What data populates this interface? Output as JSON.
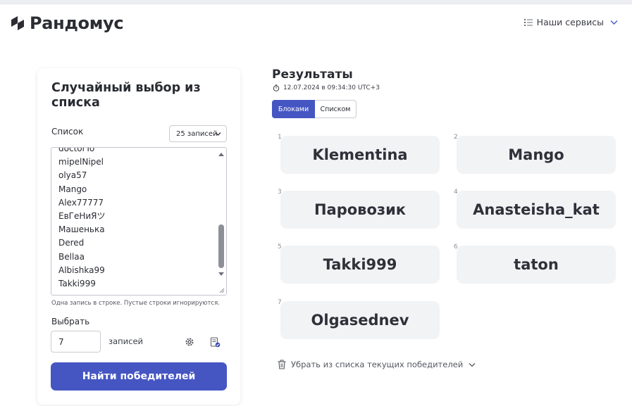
{
  "header": {
    "logo_text": "Рандомус",
    "services_label": "Наши сервисы"
  },
  "form": {
    "title": "Случайный выбор из списка",
    "list_label": "Список",
    "count_select_value": "25 записей",
    "textarea_lines": [
      "doctorTo",
      "mipelNipel",
      "olya57",
      "Mango",
      "Alex77777",
      "ЕвГеНиЯツ",
      "Машенька",
      "Dered",
      "Bellaa",
      "Albishka99",
      "Takki999"
    ],
    "hint": "Одна запись в строке. Пустые строки игнорируются.",
    "choose_label": "Выбрать",
    "choose_value": "7",
    "records_label": "записей",
    "submit_label": "Найти победителей"
  },
  "results": {
    "title": "Результаты",
    "timestamp": "12.07.2024 в 09:34:30 UTC+3",
    "view_blocks_label": "Блоками",
    "view_list_label": "Списком",
    "winners": [
      {
        "num": "1",
        "name": "Klementina"
      },
      {
        "num": "2",
        "name": "Mango"
      },
      {
        "num": "3",
        "name": "Паровозик"
      },
      {
        "num": "4",
        "name": "Anasteisha_kat"
      },
      {
        "num": "5",
        "name": "Takki999"
      },
      {
        "num": "6",
        "name": "taton"
      },
      {
        "num": "7",
        "name": "Olgasednev"
      }
    ],
    "remove_label": "Убрать из списка текущих победителей"
  },
  "colors": {
    "accent": "#4556c3",
    "winner_bg": "#f2f3f5"
  }
}
